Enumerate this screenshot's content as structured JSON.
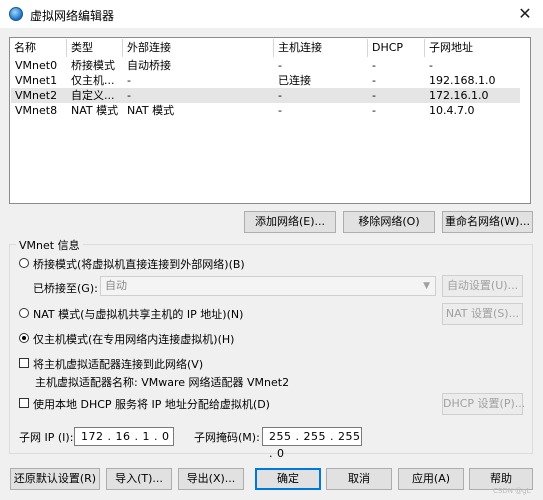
{
  "window": {
    "title": "虚拟网络编辑器",
    "close_glyph": "✕"
  },
  "table": {
    "headers": [
      "名称",
      "类型",
      "外部连接",
      "主机连接",
      "DHCP",
      "子网地址"
    ],
    "rows": [
      [
        "VMnet0",
        "桥接模式",
        "自动桥接",
        "-",
        "-",
        "-"
      ],
      [
        "VMnet1",
        "仅主机...",
        "-",
        "已连接",
        "-",
        "192.168.1.0"
      ],
      [
        "VMnet2",
        "自定义...",
        "-",
        "-",
        "-",
        "172.16.1.0"
      ],
      [
        "VMnet8",
        "NAT 模式",
        "NAT 模式",
        "-",
        "-",
        "10.4.7.0"
      ]
    ],
    "selected_row": 2
  },
  "table_buttons": {
    "add": "添加网络(E)...",
    "remove": "移除网络(O)",
    "rename": "重命名网络(W)..."
  },
  "vmnet_info": {
    "group_title": "VMnet 信息",
    "bridged": {
      "label": "桥接模式(将虚拟机直接连接到外部网络)(B)",
      "selected": false
    },
    "bridge_to_label": "已桥接至(G):",
    "bridge_to_value": "自动",
    "auto_settings": "自动设置(U)...",
    "nat": {
      "label": "NAT 模式(与虚拟机共享主机的 IP 地址)(N)",
      "selected": false
    },
    "nat_settings": "NAT 设置(S)...",
    "host_only": {
      "label": "仅主机模式(在专用网络内连接虚拟机)(H)",
      "selected": true
    },
    "connect_adapter": {
      "label": "将主机虚拟适配器连接到此网络(V)",
      "checked": false
    },
    "adapter_name_label": "主机虚拟适配器名称: VMware 网络适配器 VMnet2",
    "use_dhcp": {
      "label": "使用本地 DHCP 服务将 IP 地址分配给虚拟机(D)",
      "checked": false
    },
    "dhcp_settings": "DHCP 设置(P)...",
    "subnet_ip_label": "子网 IP (I):",
    "subnet_ip": "172 . 16 . 1 . 0",
    "subnet_mask_label": "子网掩码(M):",
    "subnet_mask": "255 . 255 . 255 . 0"
  },
  "footer_buttons": {
    "restore": "还原默认设置(R)",
    "import": "导入(T)...",
    "export": "导出(X)...",
    "ok": "确定",
    "cancel": "取消",
    "apply": "应用(A)",
    "help": "帮助"
  },
  "watermark": "CSDN @gL"
}
